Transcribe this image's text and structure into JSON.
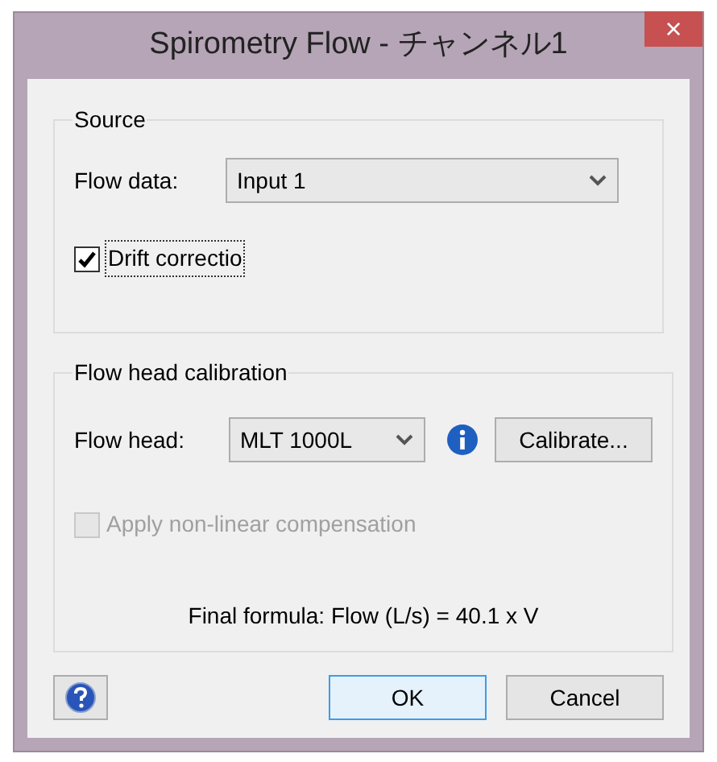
{
  "window": {
    "title": "Spirometry Flow - チャンネル1",
    "close": "×"
  },
  "source": {
    "legend": "Source",
    "flow_data": {
      "label": "Flow data:",
      "value": "Input 1"
    },
    "drift": {
      "label": "Drift correctio",
      "checked": true,
      "disabled": false
    }
  },
  "calibration": {
    "legend": "Flow head calibration",
    "flow_head": {
      "label": "Flow head:",
      "value": "MLT 1000L"
    },
    "calibrate_button": "Calibrate...",
    "nonlinear": {
      "label": "Apply non-linear compensation",
      "checked": false,
      "disabled": true
    },
    "formula": "Final formula: Flow (L/s) = 40.1 x V"
  },
  "buttons": [
    {
      "label": "OK",
      "default": true
    },
    {
      "label": "Cancel",
      "default": false
    }
  ]
}
